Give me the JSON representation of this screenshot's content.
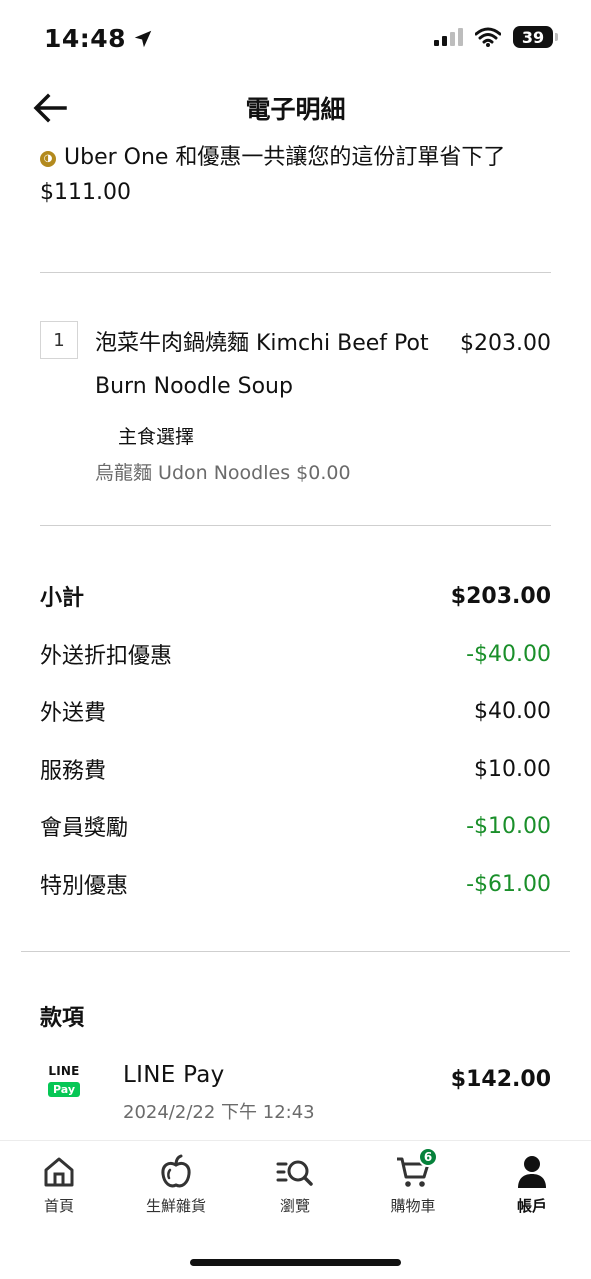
{
  "status_bar": {
    "time": "14:48",
    "battery": "39"
  },
  "header": {
    "title": "電子明細"
  },
  "savings": {
    "text": "Uber One 和優惠一共讓您的這份訂單省下了 $111.00"
  },
  "item": {
    "quantity": "1",
    "name": "泡菜牛肉鍋燒麵 Kimchi Beef Pot Burn Noodle Soup",
    "price": "$203.00",
    "option_heading": "主食選擇",
    "option_value": "烏龍麵 Udon Noodles $0.00"
  },
  "summary": [
    {
      "label": "小計",
      "value": "$203.00"
    },
    {
      "label": "外送折扣優惠",
      "value": "-$40.00"
    },
    {
      "label": "外送費",
      "value": "$40.00"
    },
    {
      "label": "服務費",
      "value": "$10.00"
    },
    {
      "label": "會員獎勵",
      "value": "-$10.00"
    },
    {
      "label": "特別優惠",
      "value": "-$61.00"
    }
  ],
  "payments": {
    "title": "款項",
    "logo_line": "LINE",
    "logo_pay": "Pay",
    "method": "LINE Pay",
    "datetime": "2024/2/22 下午 12:43",
    "amount": "$142.00"
  },
  "tabs": [
    {
      "label": "首頁",
      "icon": "home-icon"
    },
    {
      "label": "生鮮雜貨",
      "icon": "apple-icon"
    },
    {
      "label": "瀏覽",
      "icon": "browse-icon"
    },
    {
      "label": "購物車",
      "icon": "cart-icon",
      "badge": "6"
    },
    {
      "label": "帳戶",
      "icon": "account-icon",
      "active": true
    }
  ],
  "colors": {
    "discount_green": "#1a8f2a",
    "badge_green": "#06823b",
    "line_green": "#06c755",
    "uber_one_gold": "#b38a1e"
  }
}
